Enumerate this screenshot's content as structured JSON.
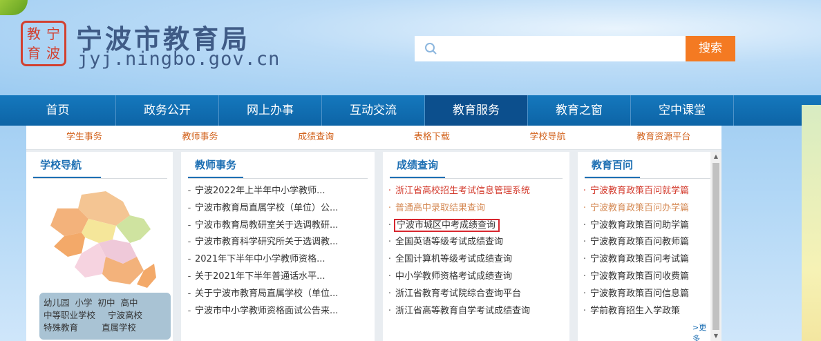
{
  "header": {
    "seal_chars": [
      "教",
      "宁",
      "育",
      "波"
    ],
    "title": "宁波市教育局",
    "domain": "jyj.ningbo.gov.cn"
  },
  "search": {
    "value": "",
    "placeholder": "",
    "button": "搜索"
  },
  "nav": [
    "首页",
    "政务公开",
    "网上办事",
    "互动交流",
    "教育服务",
    "教育之窗",
    "空中课堂"
  ],
  "subnav": [
    "学生事务",
    "教师事务",
    "成绩查询",
    "表格下载",
    "学校导航",
    "教育资源平台"
  ],
  "school_nav": {
    "title": "学校导航",
    "row1": [
      "幼儿园",
      "小学",
      "初中",
      "高中"
    ],
    "row2": [
      "中等职业学校",
      "宁波高校"
    ],
    "row3": [
      "特殊教育",
      "直属学校"
    ]
  },
  "teacher": {
    "title": "教师事务",
    "items": [
      "宁波2022年上半年中小学教师...",
      "宁波市教育局直属学校（单位）公...",
      "宁波市教育局教研室关于选调教研...",
      "宁波市教育科学研究所关于选调教...",
      "2021年下半年中小学教师资格...",
      "关于2021年下半年普通话水平...",
      "关于宁波市教育局直属学校（单位...",
      "宁波市中小学教师资格面试公告来..."
    ]
  },
  "scores": {
    "title": "成绩查询",
    "items": [
      "浙江省高校招生考试信息管理系统",
      "普通高中录取结果查询",
      "宁波市城区中考成绩查询",
      "全国英语等级考试成绩查询",
      "全国计算机等级考试成绩查询",
      "中小学教师资格考试成绩查询",
      "浙江省教育考试院综合查询平台",
      "浙江省高等教育自学考试成绩查询"
    ]
  },
  "faq": {
    "title": "教育百问",
    "items": [
      "宁波教育政策百问就学篇",
      "宁波教育政策百问办学篇",
      "宁波教育政策百问助学篇",
      "宁波教育政策百问教师篇",
      "宁波教育政策百问考试篇",
      "宁波教育政策百问收费篇",
      "宁波教育政策百问信息篇",
      "学前教育招生入学政策"
    ],
    "more": ">更多"
  },
  "colors": {
    "nav": "#1578bd",
    "nav_active": "#0c4f8d",
    "accent": "#f47a22",
    "title": "#1d6fb3",
    "highlight": "#d7262e"
  }
}
